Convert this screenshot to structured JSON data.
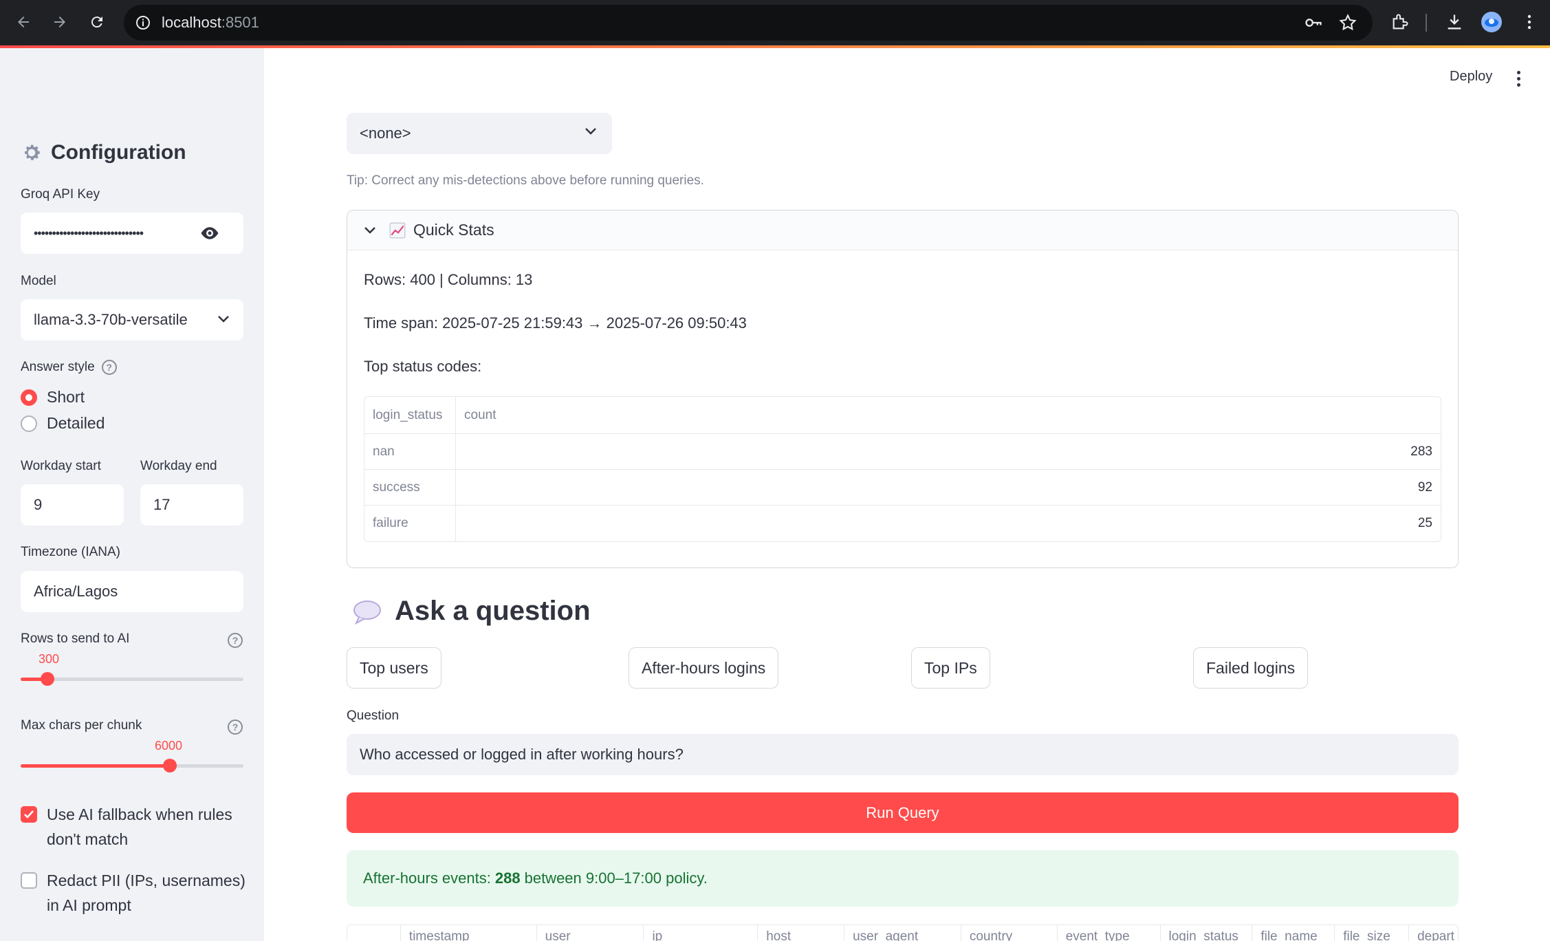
{
  "browser": {
    "url_host": "localhost",
    "url_port": ":8501"
  },
  "header": {
    "deploy_label": "Deploy"
  },
  "sidebar": {
    "title": "Configuration",
    "title_icon": "gear-icon",
    "api_key_label": "Groq API Key",
    "api_key_value": "••••••••••••••••••••••••••••••",
    "model_label": "Model",
    "model_value": "llama-3.3-70b-versatile",
    "answer_style_label": "Answer style",
    "answer_style_options": [
      "Short",
      "Detailed"
    ],
    "answer_style_selected": "Short",
    "workday_start_label": "Workday start",
    "workday_start_value": "9",
    "workday_end_label": "Workday end",
    "workday_end_value": "17",
    "timezone_label": "Timezone (IANA)",
    "timezone_value": "Africa/Lagos",
    "rows_label": "Rows to send to AI",
    "rows_value": "300",
    "rows_fraction": 0.12,
    "chunk_label": "Max chars per chunk",
    "chunk_value": "6000",
    "chunk_fraction": 0.67,
    "ai_fallback_label": "Use AI fallback when rules don't match",
    "ai_fallback_checked": true,
    "redact_label": "Redact PII (IPs, usernames) in AI prompt",
    "redact_checked": false
  },
  "main": {
    "column_select_value": "<none>",
    "tip": "Tip: Correct any mis-detections above before running queries.",
    "quick_stats": {
      "title": "Quick Stats",
      "rows_cols": "Rows: 400 | Columns: 13",
      "time_span": "Time span: 2025-07-25 21:59:43 → 2025-07-26 09:50:43",
      "top_status_label": "Top status codes:",
      "table_headers": [
        "login_status",
        "count"
      ],
      "table_rows": [
        {
          "status": "nan",
          "count": "283"
        },
        {
          "status": "success",
          "count": "92"
        },
        {
          "status": "failure",
          "count": "25"
        }
      ]
    },
    "ask_title": "Ask a question",
    "quick_buttons": [
      "Top users",
      "After-hours logins",
      "Top IPs",
      "Failed logins"
    ],
    "question_label": "Question",
    "question_value": "Who accessed or logged in after working hours?",
    "run_label": "Run Query",
    "result": {
      "prefix": "After-hours events:",
      "count": "288",
      "suffix": "between 9:00–17:00 policy."
    },
    "result_columns": [
      "",
      "timestamp",
      "user",
      "ip",
      "host",
      "user_agent",
      "country",
      "event_type",
      "login_status",
      "file_name",
      "file_size",
      "depart"
    ]
  },
  "colors": {
    "accent": "#ff4b4b",
    "sidebar_bg": "#f0f2f6",
    "success_bg": "#e8f8ee",
    "success_text": "#177233"
  }
}
